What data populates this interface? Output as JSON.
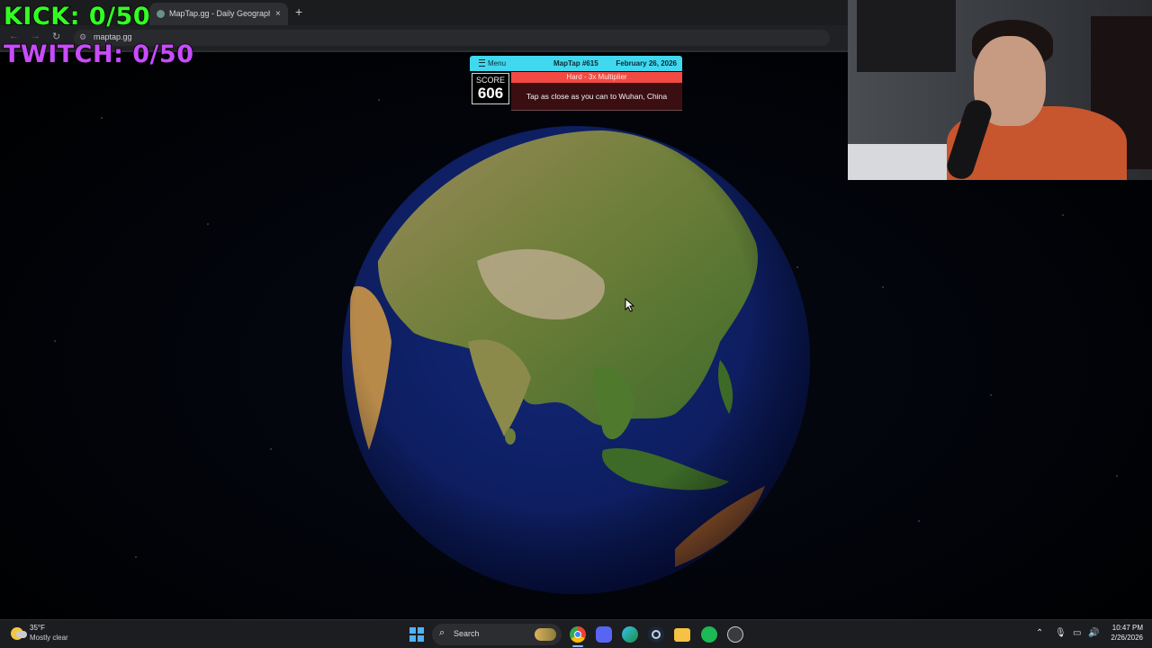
{
  "browser": {
    "tab_title": "MapTap.gg - Daily Geography Game",
    "tab_close": "×",
    "new_tab": "+",
    "url": "maptap.gg",
    "back_icon": "arrow-left-icon",
    "forward_icon": "arrow-right-icon",
    "reload_icon": "reload-icon"
  },
  "stream_overlay": {
    "kick": "KICK: 0/50",
    "twitch": "TWITCH: 0/50",
    "kick_color": "#33ff23",
    "twitch_color": "#c94bff"
  },
  "game": {
    "menu_label": "Menu",
    "puzzle_number": "MapTap #615",
    "date": "February 26, 2026",
    "score_label": "SCORE",
    "score_value": "606",
    "difficulty": "Hard - 3x Multiplier",
    "prompt": "Tap as close as you can to Wuhan, China",
    "accent_color": "#40d8ef",
    "difficulty_color": "#f24a43"
  },
  "taskbar": {
    "weather_temp": "35°F",
    "weather_desc": "Mostly clear",
    "search_label": "Search",
    "apps": [
      "chrome-icon",
      "discord-icon",
      "edge-icon",
      "steam-icon",
      "file-explorer-icon",
      "spotify-icon",
      "app-icon"
    ],
    "time": "10:47 PM",
    "date": "2/26/2026"
  }
}
